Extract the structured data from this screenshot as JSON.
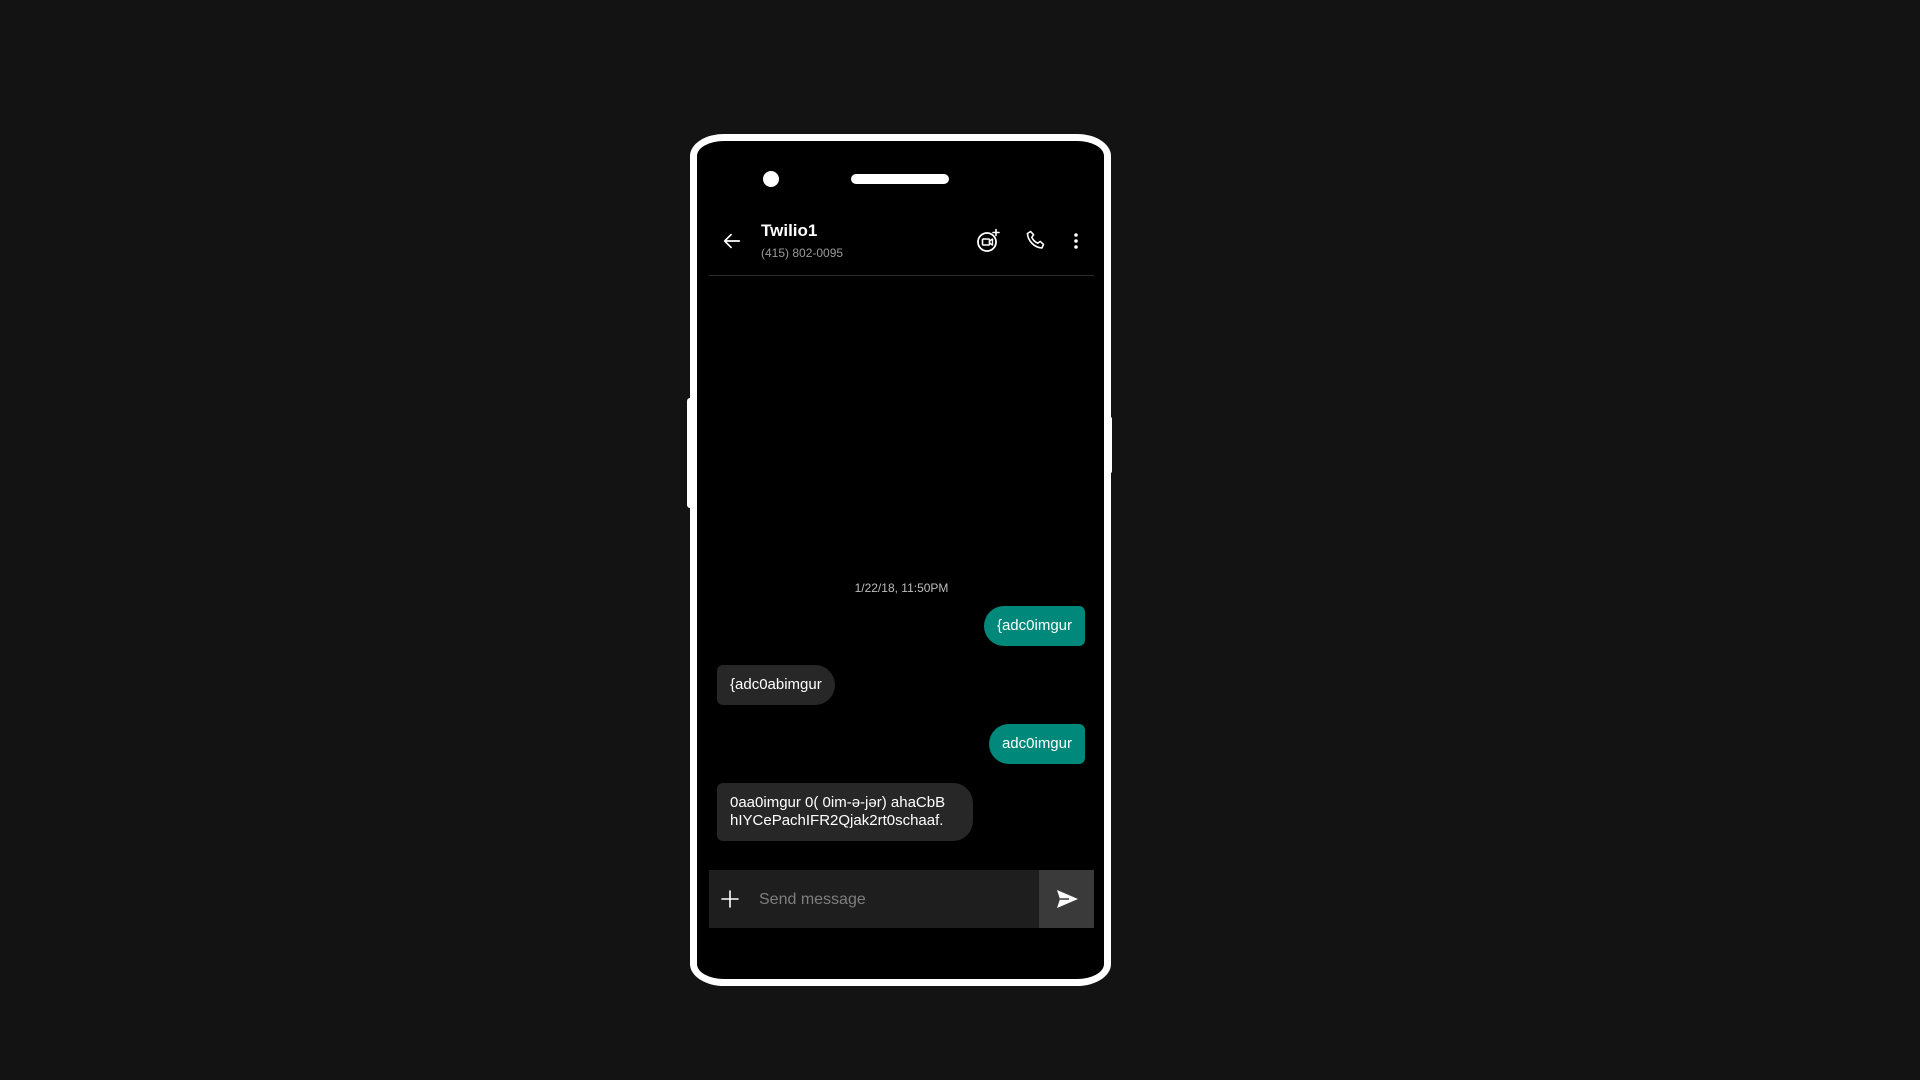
{
  "header": {
    "back_icon": "arrow-left-icon",
    "contact_name": "Twilio1",
    "contact_number": "(415) 802-0095",
    "actions": [
      {
        "name": "video-call",
        "icon": "video-add-icon"
      },
      {
        "name": "call",
        "icon": "phone-icon"
      },
      {
        "name": "more",
        "icon": "more-vertical-icon"
      }
    ]
  },
  "conversation": {
    "timestamp": "1/22/18, 11:50PM",
    "messages": [
      {
        "direction": "outgoing",
        "text": "{adc0imgur"
      },
      {
        "direction": "incoming",
        "text": "{adc0abimgur"
      },
      {
        "direction": "outgoing",
        "text": "adc0imgur"
      },
      {
        "direction": "incoming",
        "text": "0aa0imgur 0( 0im-ə-jər) ahaCbB hIYCePachIFR2Qjak2rt0schaaf."
      }
    ]
  },
  "composer": {
    "attach_icon": "plus-icon",
    "placeholder": "Send message",
    "value": "",
    "send_icon": "send-icon"
  },
  "colors": {
    "background": "#131313",
    "screen": "#000000",
    "outgoing_bubble": "#00897b",
    "incoming_bubble": "#272727",
    "send_button": "#3a3a3a"
  }
}
